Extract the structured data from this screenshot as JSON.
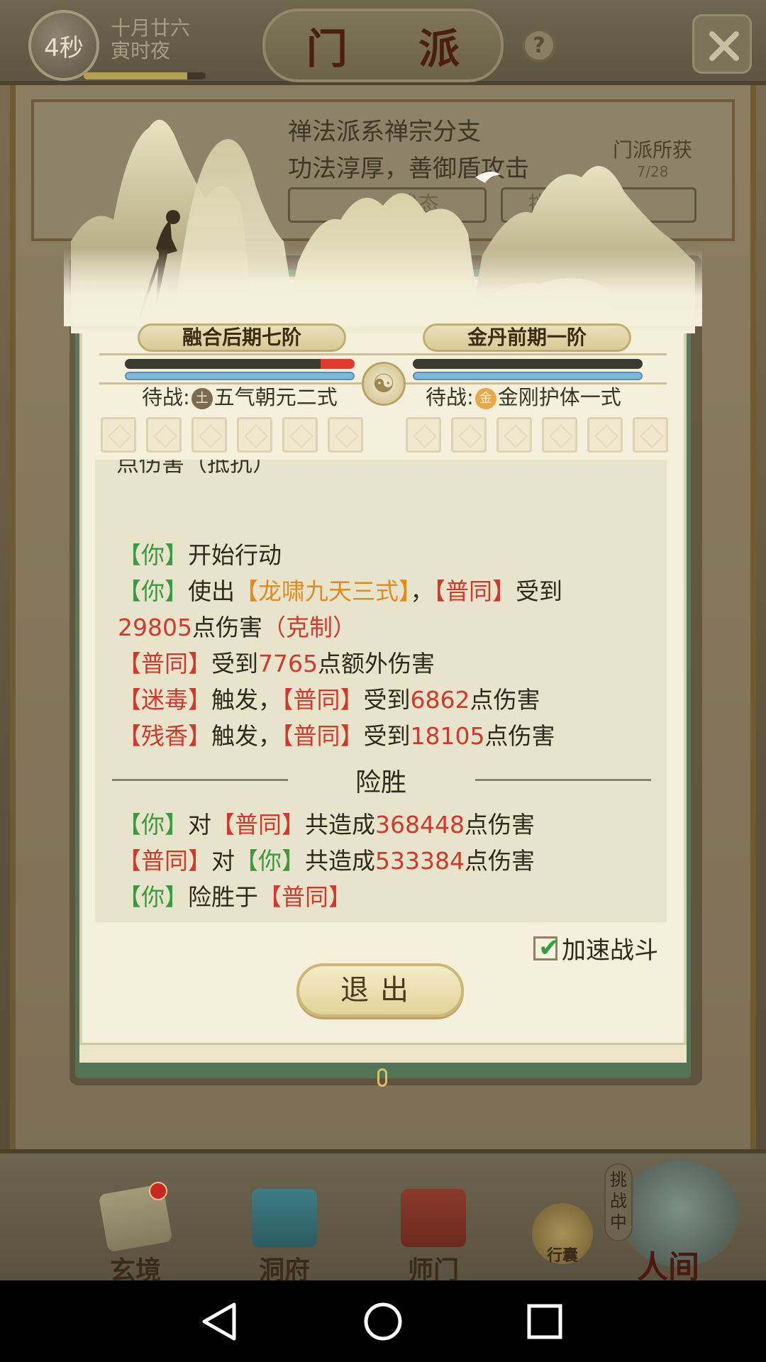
{
  "header": {
    "timer": "4秒",
    "date_line1": "十月廿六",
    "date_line2": "寅时夜",
    "time_progress": 0.85,
    "title": "门 派",
    "help_label": "?"
  },
  "sect_info": {
    "desc_line1": "禅法派系禅宗分支",
    "desc_line2": "功法淳厚，善御盾攻击",
    "gain_label": "门派所获",
    "gain_count": "7/28",
    "pill1": "状态",
    "pill2": "挑战"
  },
  "battle": {
    "left": {
      "name": "融合后期七阶",
      "hp_fraction": 1.0,
      "damage_fraction": 0.15,
      "wait_prefix": "待战:",
      "element": "土",
      "skill": "五气朝元二式"
    },
    "right": {
      "name": "金丹前期一阶",
      "hp_fraction": 1.0,
      "wait_prefix": "待战:",
      "element": "金",
      "skill": "金刚护体一式"
    },
    "taiji_icon": "taiji-icon",
    "slot_count_each": 6
  },
  "log": {
    "partial_line": "点伤害（抵抗）",
    "lines": {
      "l1": {
        "a": "【你】",
        "b": "开始行动"
      },
      "l2": {
        "a": "【你】",
        "b": "使出",
        "c": "【龙啸九天三式】",
        "d": "，",
        "e": "【普同】",
        "f": "受到"
      },
      "l3": {
        "a": "29805",
        "b": "点伤害",
        "c": "（克制）"
      },
      "l4": {
        "a": "【普同】",
        "b": "受到",
        "c": "7765",
        "d": "点额外伤害"
      },
      "l5": {
        "a": "【迷毒】",
        "b": "触发，",
        "c": "【普同】",
        "d": "受到",
        "e": "6862",
        "f": "点伤害"
      },
      "l6": {
        "a": "【残香】",
        "b": "触发，",
        "c": "【普同】",
        "d": "受到",
        "e": "18105",
        "f": "点伤害"
      }
    },
    "result_title": "险胜",
    "result": {
      "r1": {
        "a": "【你】",
        "b": "对",
        "c": "【普同】",
        "d": "共造成",
        "e": "368448",
        "f": "点伤害"
      },
      "r2": {
        "a": "【普同】",
        "b": "对",
        "c": "【你】",
        "d": "共造成",
        "e": "533384",
        "f": "点伤害"
      },
      "r3": {
        "a": "【你】",
        "b": "险胜于",
        "c": "【普同】"
      }
    }
  },
  "controls": {
    "speed_label": "加速战斗",
    "speed_checked": true,
    "exit_label": "退出"
  },
  "bottom_nav": {
    "items": [
      "玄境",
      "洞府",
      "师门",
      "行囊",
      "人间"
    ],
    "challenge_tag": "挑战中"
  },
  "colors": {
    "player_green": "#3c9a3e",
    "enemy_red": "#d1392c",
    "skill_orange": "#e48a1a"
  }
}
